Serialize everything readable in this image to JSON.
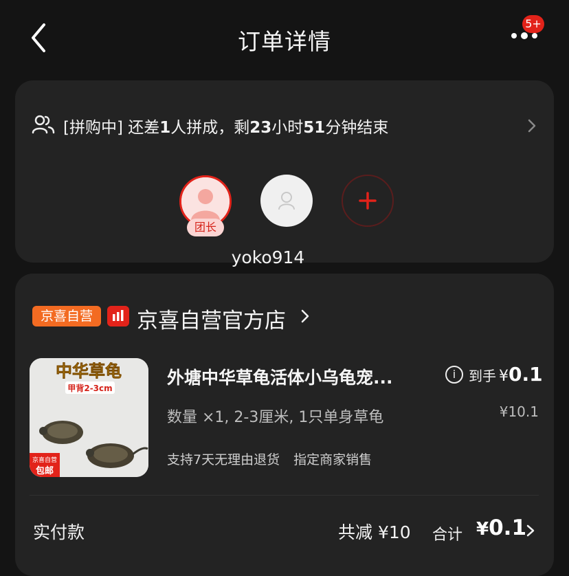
{
  "header": {
    "title": "订单详情",
    "badge": "5+",
    "back_icon": "chevron-left-icon",
    "more_icon": "more-dots-icon"
  },
  "group": {
    "status_prefix": "[拼购中] 还差",
    "missing_count": "1",
    "status_mid": "人拼成，剩",
    "hours": "23",
    "hours_unit": "小时",
    "minutes": "51",
    "minutes_unit": "分钟结束",
    "leader_tag": "团长",
    "leader_name": "yoko914",
    "colors": {
      "accent": "#e2231a",
      "leader_tag_bg": "#fbd5d3"
    }
  },
  "store": {
    "tag": "京喜自营",
    "name": "京喜自营官方店"
  },
  "product": {
    "image_caption": "中华草龟",
    "image_subcaption": "甲背2-3cm",
    "image_tag": "京喜自营\n包邮",
    "title": "外塘中华草龟活体小乌龟宠...",
    "price_label": "到手",
    "price_currency": "¥",
    "price_value": "0.1",
    "original_price": "¥10.1",
    "spec": "数量 ×1, 2-3厘米, 1只单身草龟",
    "services": [
      "支持7天无理由退货",
      "指定商家销售"
    ]
  },
  "summary": {
    "paid_label": "实付款",
    "discount_text": "共减 ¥10",
    "total_label": "合计",
    "total_currency": "¥",
    "total_value": "0.1"
  }
}
